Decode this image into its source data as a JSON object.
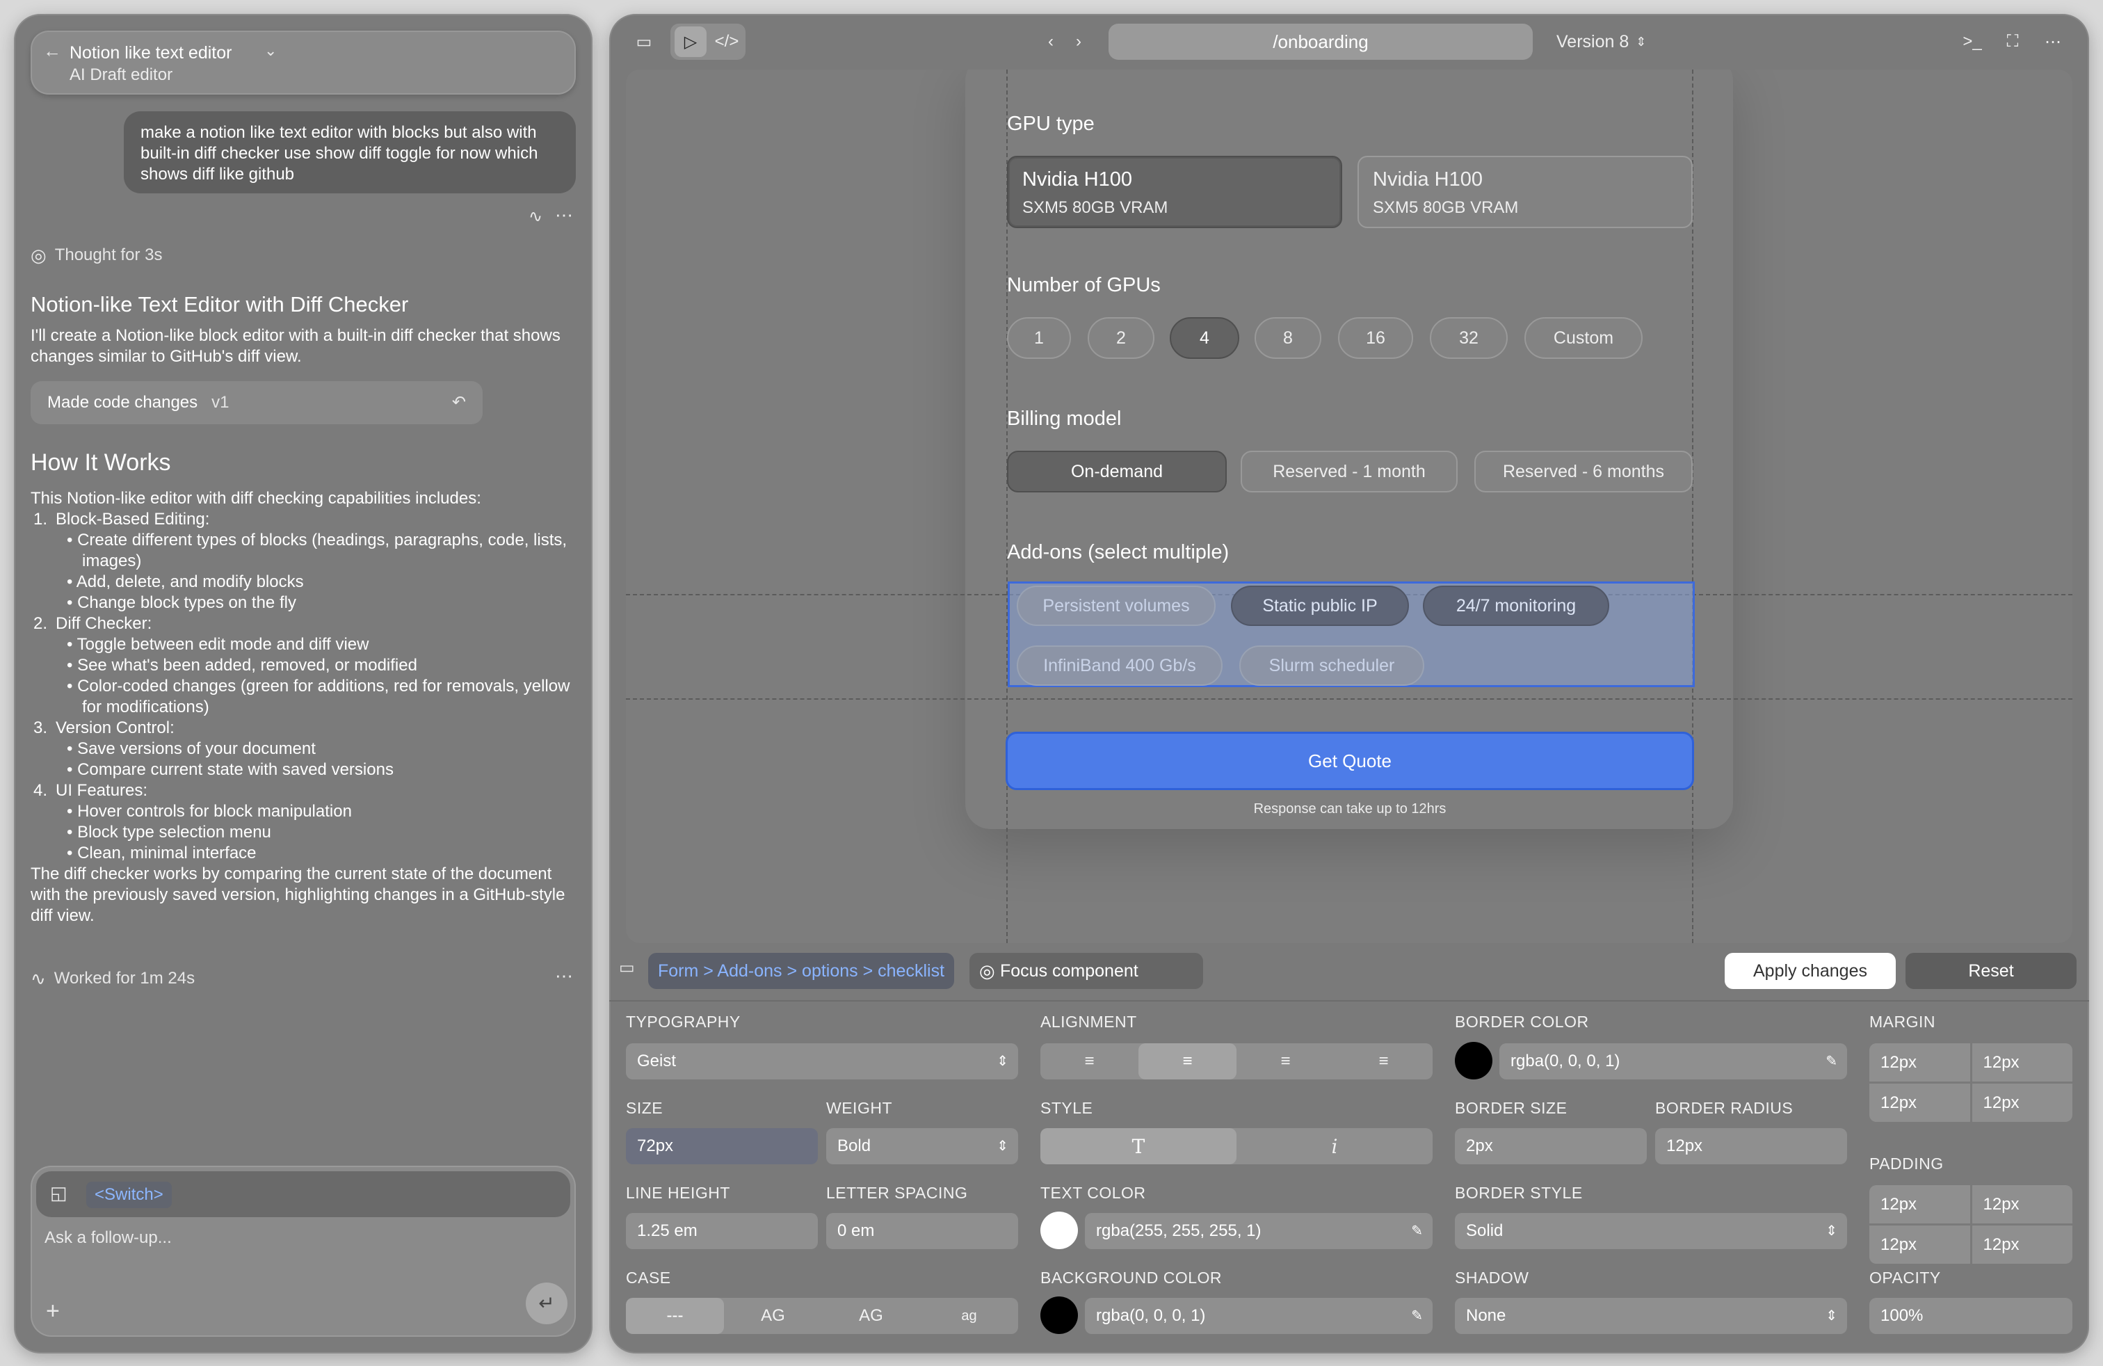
{
  "left_panel": {
    "project_title": "Notion like text editor",
    "project_subtitle": "AI Draft editor",
    "user_message": "make a notion like text editor with blocks but also with built-in diff checker use show diff toggle for now which shows diff like github",
    "thought": "Thought for 3s",
    "heading": "Notion-like Text Editor with Diff Checker",
    "intro": "I'll create a Notion-like block editor with a built-in diff checker that shows changes similar to GitHub's diff view.",
    "code_chip_label": "Made code changes",
    "code_chip_version": "v1",
    "how_heading": "How It Works",
    "how_intro": "This Notion-like editor with diff checking capabilities includes:",
    "items": [
      {
        "num": "1.",
        "title": "Block-Based Editing:",
        "bullets": [
          "Create different types of blocks (headings, paragraphs, code, lists, images)",
          "Add, delete, and modify blocks",
          "Change block types on the fly"
        ]
      },
      {
        "num": "2.",
        "title": "Diff Checker:",
        "bullets": [
          "Toggle between edit mode and diff view",
          "See what's been added, removed, or modified",
          "Color-coded changes (green for additions, red for removals, yellow for modifications)"
        ]
      },
      {
        "num": "3.",
        "title": "Version Control:",
        "bullets": [
          "Save versions of your document",
          "Compare current state with saved versions"
        ]
      },
      {
        "num": "4.",
        "title": "UI Features:",
        "bullets": [
          "Hover controls for block manipulation",
          "Block type selection menu",
          "Clean, minimal interface"
        ]
      }
    ],
    "outro": "The diff checker works by comparing the current state of the document with the previously saved version, highlighting changes in a GitHub-style diff view.",
    "worked": "Worked for 1m 24s",
    "switch_tag": "<Switch>",
    "placeholder": "Ask a follow-up..."
  },
  "toolbar": {
    "url": "/onboarding",
    "version": "Version 8"
  },
  "form": {
    "gpu_label": "GPU type",
    "gpu_options": [
      {
        "name": "Nvidia H100",
        "spec": "SXM5 80GB VRAM"
      },
      {
        "name": "Nvidia H100",
        "spec": "SXM5 80GB VRAM"
      }
    ],
    "num_label": "Number of GPUs",
    "num_options": [
      "1",
      "2",
      "4",
      "8",
      "16",
      "32",
      "Custom"
    ],
    "billing_label": "Billing model",
    "billing_options": [
      "On-demand",
      "Reserved - 1 month",
      "Reserved - 6 months"
    ],
    "addons_label": "Add-ons (select multiple)",
    "addons": [
      "Persistent volumes",
      "Static public IP",
      "24/7 monitoring",
      "InfiniBand 400 Gb/s",
      "Slurm scheduler"
    ],
    "cta": "Get Quote",
    "note": "Response can take up to 12hrs"
  },
  "inspector": {
    "breadcrumb": "Form > Add-ons > options > checklist",
    "focus": "Focus component",
    "apply": "Apply changes",
    "reset": "Reset",
    "typography_label": "TYPOGRAPHY",
    "font": "Geist",
    "size_label": "SIZE",
    "size": "72px",
    "weight_label": "WEIGHT",
    "weight": "Bold",
    "lineheight_label": "LINE HEIGHT",
    "lineheight": "1.25 em",
    "letterspacing_label": "LETTER SPACING",
    "letterspacing": "0 em",
    "case_label": "CASE",
    "case_options": [
      "---",
      "AG",
      "AG",
      "ag"
    ],
    "alignment_label": "ALIGNMENT",
    "style_label": "STYLE",
    "style_options": [
      "T",
      "i"
    ],
    "textcolor_label": "TEXT COLOR",
    "textcolor": "rgba(255, 255, 255, 1)",
    "bgcolor_label": "BACKGROUND COLOR",
    "bgcolor": "rgba(0, 0, 0, 1)",
    "bordercolor_label": "BORDER COLOR",
    "bordercolor": "rgba(0, 0, 0, 1)",
    "bordersize_label": "BORDER SIZE",
    "bordersize": "2px",
    "borderradius_label": "BORDER RADIUS",
    "borderradius": "12px",
    "borderstyle_label": "BORDER STYLE",
    "borderstyle": "Solid",
    "shadow_label": "SHADOW",
    "shadow": "None",
    "margin_label": "MARGIN",
    "margin": [
      "12px",
      "12px",
      "12px",
      "12px"
    ],
    "padding_label": "PADDING",
    "padding": [
      "12px",
      "12px",
      "12px",
      "12px"
    ],
    "opacity_label": "OPACITY",
    "opacity": "100%"
  },
  "colors": {
    "accent": "#4d7ce8",
    "selection": "#3d6adb",
    "crumb_text": "#8ab4ff"
  }
}
